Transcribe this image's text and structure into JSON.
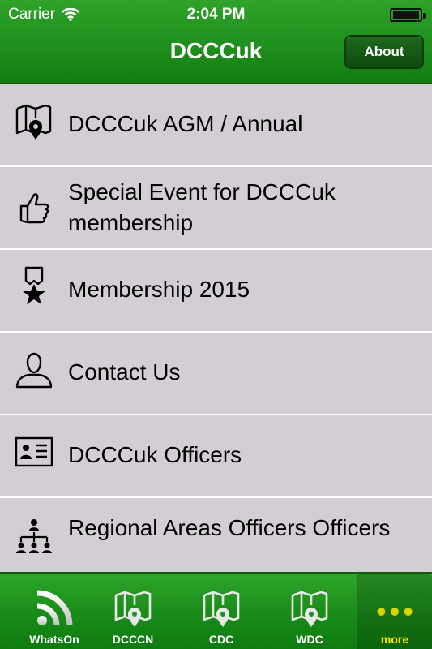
{
  "status": {
    "carrier": "Carrier",
    "time": "2:04 PM"
  },
  "header": {
    "title": "DCCCuk",
    "about_label": "About"
  },
  "list": {
    "items": [
      {
        "label": "DCCCuk AGM / Annual",
        "icon": "map-pin-icon"
      },
      {
        "label": "Special Event for DCCCuk membership",
        "icon": "thumbs-up-icon"
      },
      {
        "label": "Membership 2015",
        "icon": "medal-star-icon"
      },
      {
        "label": "Contact Us",
        "icon": "person-icon"
      },
      {
        "label": "DCCCuk Officers",
        "icon": "id-card-icon"
      },
      {
        "label": "Regional Areas Officers Officers",
        "icon": "org-chart-icon"
      }
    ]
  },
  "tabbar": {
    "tabs": [
      {
        "label": "WhatsOn",
        "icon": "rss-feed-icon"
      },
      {
        "label": "DCCCN",
        "icon": "map-pin-icon"
      },
      {
        "label": "CDC",
        "icon": "map-pin-icon"
      },
      {
        "label": "WDC",
        "icon": "map-pin-icon"
      },
      {
        "label": "more",
        "icon": "more-dots-icon",
        "active": true
      }
    ],
    "active_color": "#ffe400"
  },
  "colors": {
    "bar_green": "#1f8f1d",
    "row_bg": "#d2ced3"
  }
}
